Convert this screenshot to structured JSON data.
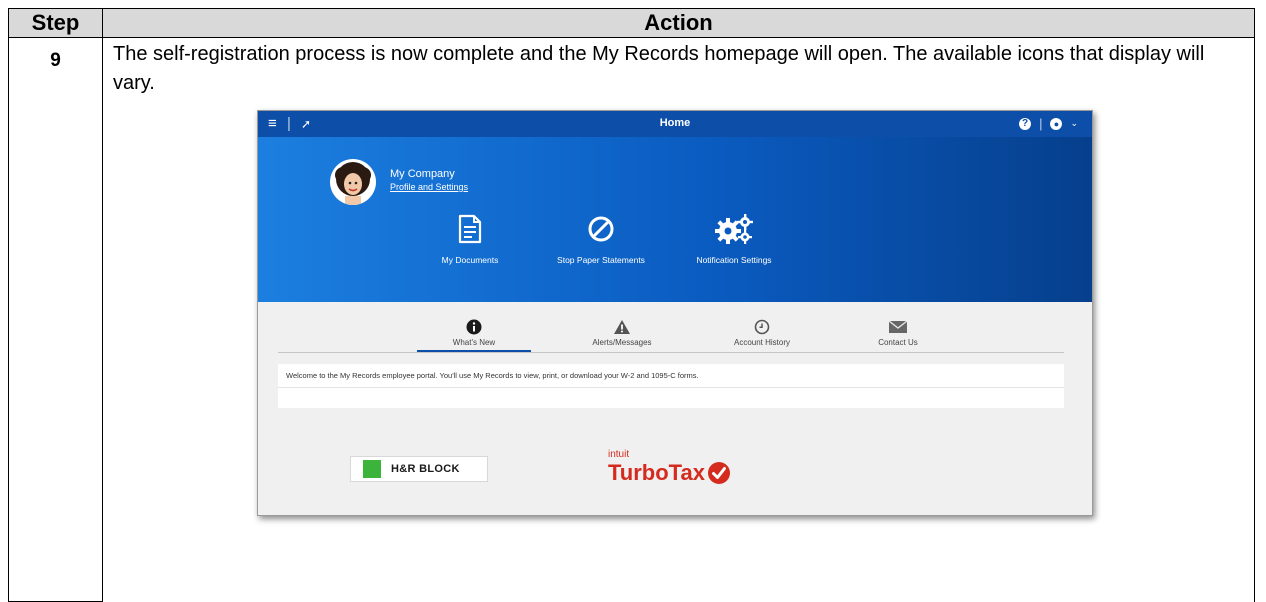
{
  "table": {
    "header_step": "Step",
    "header_action": "Action",
    "step_number": "9",
    "action_text": "The self-registration process is now complete and the My Records homepage will open. The available icons that display will vary."
  },
  "screenshot": {
    "topbar": {
      "title": "Home",
      "left_icons": [
        "menu-icon",
        "pin-icon"
      ],
      "right_icons": [
        "help-icon",
        "user-icon",
        "chevron-down-icon"
      ]
    },
    "profile": {
      "company": "My Company",
      "link": "Profile and Settings"
    },
    "tiles": [
      {
        "label": "My Documents",
        "icon": "document-icon"
      },
      {
        "label": "Stop Paper Statements",
        "icon": "prohibit-icon"
      },
      {
        "label": "Notification Settings",
        "icon": "gears-icon"
      }
    ],
    "tabs": [
      {
        "label": "What's New",
        "icon": "info-icon",
        "active": true
      },
      {
        "label": "Alerts/Messages",
        "icon": "warning-icon",
        "active": false
      },
      {
        "label": "Account History",
        "icon": "clock-icon",
        "active": false
      },
      {
        "label": "Contact Us",
        "icon": "envelope-icon",
        "active": false
      }
    ],
    "welcome": "Welcome to the My Records employee portal. You'll use My Records to view, print, or download your W-2 and 1095-C forms.",
    "partners": {
      "hrblock": "H&R BLOCK",
      "intuit": "intuit",
      "turbotax": "TurboTax"
    },
    "colors": {
      "topbar": "#0d4fa8",
      "hero_start": "#1c7fe0",
      "hero_end": "#063f8c",
      "hrblock_green": "#3cb43c",
      "turbotax_red": "#d52b1e"
    }
  }
}
